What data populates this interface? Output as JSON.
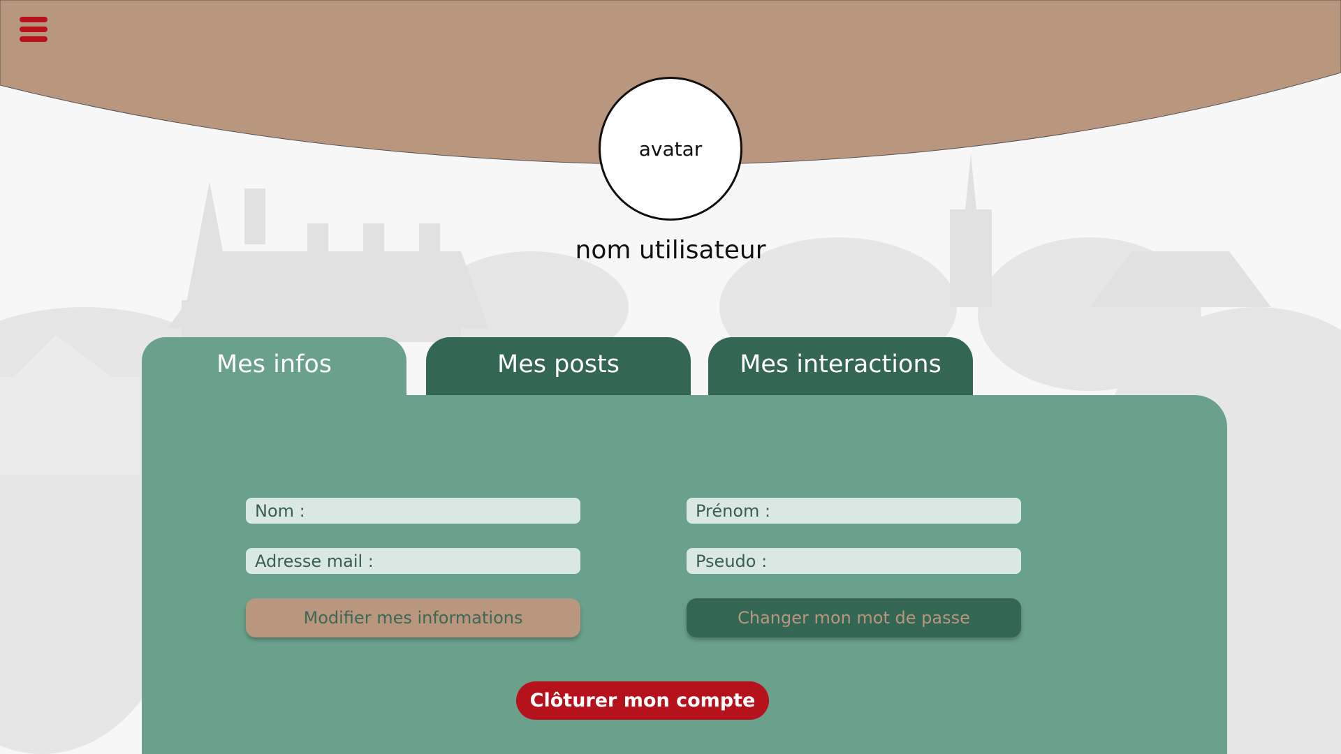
{
  "header": {
    "menu_icon": "hamburger-menu-icon",
    "avatar_label": "avatar",
    "username": "nom utilisateur"
  },
  "tabs": [
    {
      "label": "Mes infos",
      "active": true
    },
    {
      "label": "Mes posts",
      "active": false
    },
    {
      "label": "Mes interactions",
      "active": false
    }
  ],
  "form": {
    "nom_label": "Nom :",
    "prenom_label": "Prénom  :",
    "email_label": "Adresse mail  :",
    "pseudo_label": "Pseudo :",
    "modify_button": "Modifier mes informations",
    "password_button": "Changer mon mot de passe",
    "close_account_button": "Clôturer mon compte"
  },
  "colors": {
    "header_tan": "#b8977e",
    "tab_active": "#6aa18d",
    "tab_inactive": "#346654",
    "accent_red": "#b5121b",
    "field_bg": "#d9e8e2"
  }
}
